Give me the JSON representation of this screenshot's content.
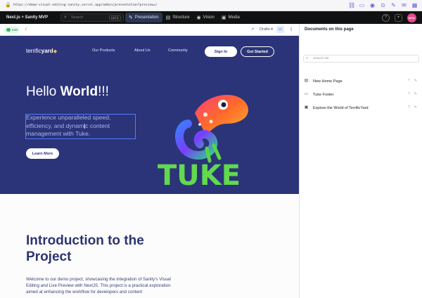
{
  "browser": {
    "url": "https://demo-visual-editing-sanity.vercel.app/admin/presentation?preview=/",
    "icons": [
      "link-icon",
      "tab-icon",
      "camera-icon",
      "record-icon",
      "pen-icon",
      "mail-icon",
      "calendar-icon"
    ]
  },
  "studio": {
    "project_name": "Next.js + Sanity MVP",
    "search_placeholder": "Search",
    "search_shortcut": "Ctrl K",
    "tabs": [
      {
        "label": "Presentation",
        "icon": "presentation-icon",
        "active": true
      },
      {
        "label": "Structure",
        "icon": "structure-icon",
        "active": false
      },
      {
        "label": "Vision",
        "icon": "eye-icon",
        "active": false
      },
      {
        "label": "Media",
        "icon": "image-icon",
        "active": false
      }
    ],
    "avatar_initials": "MYK"
  },
  "preview_toolbar": {
    "edit_label": "Edit",
    "path": "/",
    "perspective": "Drafts"
  },
  "site": {
    "logo_light": "terrific",
    "logo_bold": "yard",
    "nav": [
      "Our Products",
      "About Us",
      "Community"
    ],
    "signin_label": "Sign In",
    "started_label": "Get Started",
    "hero_title_light": "Hello ",
    "hero_title_bold": "World",
    "hero_title_end": "!!!",
    "hero_subtitle": "Experience unparalleled speed, efficiency, and dynamic content management with Tuke.",
    "learn_more_label": "Learn More",
    "tuke_word": "TUKE",
    "intro_title": "Introduction to the Project",
    "intro_body": "Welcome to our demo project, showcasing the integration of Sanity's Visual Editing and Live Preview with NextJS. This project is a practical exploration aimed at enhancing the workflow for developers and content"
  },
  "panel": {
    "title": "Documents on this page",
    "search_placeholder": "Search list",
    "documents": [
      {
        "label": "New Home Page",
        "icon": "document-icon"
      },
      {
        "label": "Tuke Footer",
        "icon": "footer-icon"
      },
      {
        "label": "Explore the World of TerrificYard",
        "icon": "section-icon"
      }
    ]
  },
  "colors": {
    "hero_bg": "#2b3478",
    "accent": "#4f7dff",
    "studio_bg": "#101112"
  }
}
